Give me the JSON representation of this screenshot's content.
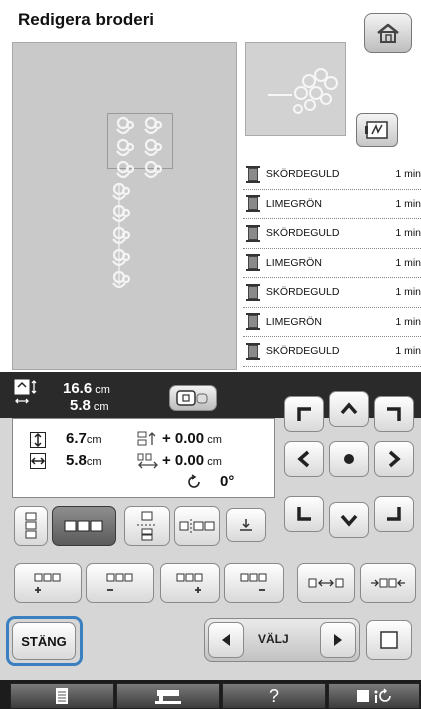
{
  "header": {
    "title": "Redigera broderi"
  },
  "home_icon": "home-icon",
  "threads": [
    {
      "name": "SKÖRDEGULD",
      "time": "1 min"
    },
    {
      "name": "LIMEGRÖN",
      "time": "1 min"
    },
    {
      "name": "SKÖRDEGULD",
      "time": "1 min"
    },
    {
      "name": "LIMEGRÖN",
      "time": "1 min"
    },
    {
      "name": "SKÖRDEGULD",
      "time": "1 min"
    },
    {
      "name": "LIMEGRÖN",
      "time": "1 min"
    },
    {
      "name": "SKÖRDEGULD",
      "time": "1 min"
    }
  ],
  "size": {
    "height": "16.6",
    "width": "5.8",
    "unit": "cm"
  },
  "info": {
    "height": "6.7",
    "width": "5.8",
    "unit": "cm",
    "offset_y": "+ 0.00",
    "offset_x": "+ 0.00",
    "rotation": "0°"
  },
  "buttons": {
    "close": "STÄNG",
    "select": "VÄLJ"
  },
  "bottom_tabs": {
    "help": "?"
  }
}
